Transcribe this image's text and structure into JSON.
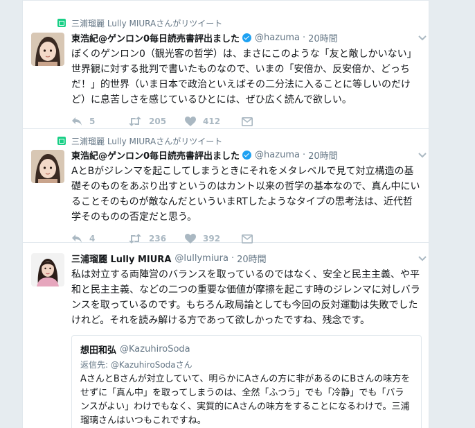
{
  "tweets": [
    {
      "context": "三浦瑠麗 Lully MIURAさんがリツイート",
      "fullname": "東浩紀@ゲンロン0毎日読売書評出ました",
      "verified": true,
      "screen_name": "@hazuma",
      "separator": "·",
      "time": "20時間",
      "text": "ぼくのゲンロン0（観光客の哲学）は、まさにこのような「友と敵しかいない」世界観に対する批判で書いたものなので、いまの「安倍か、反安倍か、どっちだ！」的世界（いま日本で政治といえばその二分法に入ることに等しいのだけど）に息苦しさを感じているひとには、ぜひ広く読んで欲しい。",
      "replies": "5",
      "retweets": "205",
      "likes": "412"
    },
    {
      "context": "三浦瑠麗 Lully MIURAさんがリツイート",
      "fullname": "東浩紀@ゲンロン0毎日読売書評出ました",
      "verified": true,
      "screen_name": "@hazuma",
      "separator": "·",
      "time": "20時間",
      "text": "AとBがジレンマを起こしてしまうときにそれをメタレベルで見て対立構造の基礎そのものをあぶり出すというのはカント以来の哲学の基本なので、真ん中にいることそのものが敵なんだといういまRTしたようなタイプの思考法は、近代哲学そのものの否定だと思う。",
      "replies": "4",
      "retweets": "236",
      "likes": "392"
    },
    {
      "fullname": "三浦瑠麗 Lully MIURA",
      "screen_name": "@lullymiura",
      "separator": "·",
      "time": "20時間",
      "text": "私は対立する両陣営のバランスを取っているのではなく、安全と民主主義、や平和と民主主義、などの二つの重要な価値が摩擦を起こす時のジレンマに対しバランスを取っているのです。もちろん政局論としても今回の反対運動は失敗でしたけれど。それを読み解ける方であって欲しかったですね、残念です。",
      "quote": {
        "fullname": "想田和弘",
        "screen_name": "@KazuhiroSoda",
        "reply_to": "返信先: @KazuhiroSodaさん",
        "text": "AさんとBさんが対立していて、明らかにAさんの方に非があるのにBさんの味方をせずに「真ん中」を取ってしまうのは、全然「ふつう」でも「冷静」でも「バランスがよい」わけでもなく、実質的にAさんの味方をすることになるわけで。三浦瑠璃さんはいつもこれですね。"
      }
    }
  ],
  "colors": {
    "retweet_badge": "#19cf86",
    "verified": "#1da1f2",
    "secondary_text": "#657786",
    "action_icon": "#aab8c2"
  },
  "icons": [
    "retweet-icon",
    "verified-icon",
    "reply-icon",
    "like-icon",
    "message-icon",
    "chevron-down-icon"
  ]
}
